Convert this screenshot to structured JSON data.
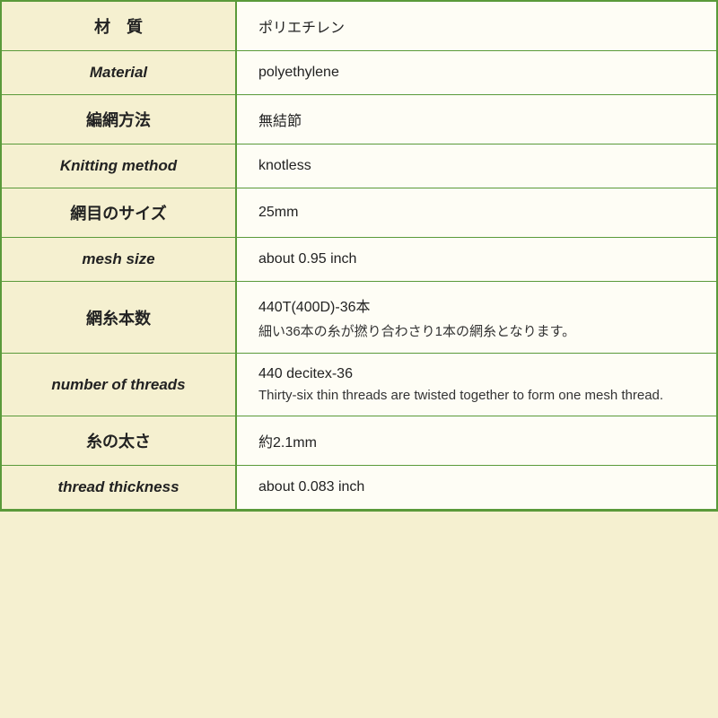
{
  "rows": [
    {
      "id": "material-ja",
      "labelJa": "材　質",
      "labelEn": null,
      "valueLines": [
        "ポリエチレン"
      ],
      "borderBottom": true
    },
    {
      "id": "material-en",
      "labelJa": null,
      "labelEn": "Material",
      "valueLines": [
        "polyethylene"
      ],
      "borderBottom": true
    },
    {
      "id": "knitting-ja",
      "labelJa": "編網方法",
      "labelEn": null,
      "valueLines": [
        "無結節"
      ],
      "borderBottom": true
    },
    {
      "id": "knitting-en",
      "labelJa": null,
      "labelEn": "Knitting method",
      "valueLines": [
        "knotless"
      ],
      "borderBottom": true
    },
    {
      "id": "mesh-ja",
      "labelJa": "網目のサイズ",
      "labelEn": null,
      "valueLines": [
        "25mm"
      ],
      "borderBottom": true
    },
    {
      "id": "mesh-en",
      "labelJa": null,
      "labelEn": "mesh size",
      "valueLines": [
        "about 0.95 inch"
      ],
      "borderBottom": true
    },
    {
      "id": "threads-ja",
      "labelJa": "網糸本数",
      "labelEn": null,
      "valueLines": [
        "440T(400D)-36本",
        "細い36本の糸が撚り合わさり1本の網糸となります。"
      ],
      "borderBottom": true
    },
    {
      "id": "threads-en",
      "labelJa": null,
      "labelEn": "number of threads",
      "valueLines": [
        "440 decitex-36",
        "Thirty-six thin threads are twisted together to form one mesh thread."
      ],
      "borderBottom": true
    },
    {
      "id": "thickness-ja",
      "labelJa": "糸の太さ",
      "labelEn": null,
      "valueLines": [
        "約2.1mm"
      ],
      "borderBottom": true
    },
    {
      "id": "thickness-en",
      "labelJa": null,
      "labelEn": "thread thickness",
      "valueLines": [
        "about 0.083 inch"
      ],
      "borderBottom": false
    }
  ]
}
